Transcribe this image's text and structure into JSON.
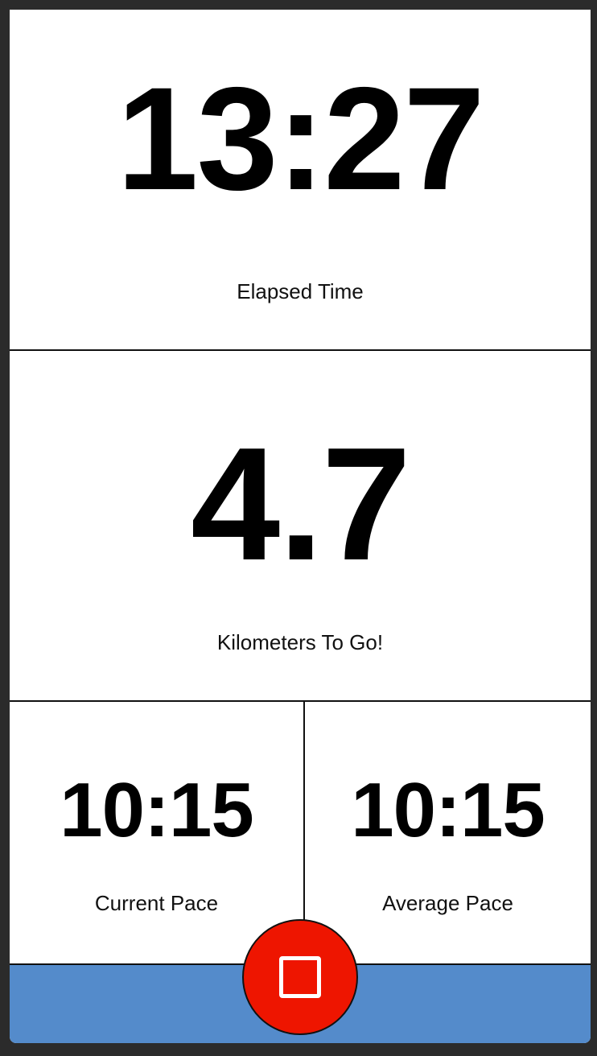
{
  "elapsed": {
    "value": "13:27",
    "label": "Elapsed Time"
  },
  "distance": {
    "value": "4.7",
    "label": "Kilometers To Go!"
  },
  "current_pace": {
    "value": "10:15",
    "label": "Current Pace"
  },
  "average_pace": {
    "value": "10:15",
    "label": "Average Pace"
  },
  "controls": {
    "stop_icon": "stop-square-icon",
    "stop_color": "#ee1500",
    "bar_color": "#548bcb"
  }
}
